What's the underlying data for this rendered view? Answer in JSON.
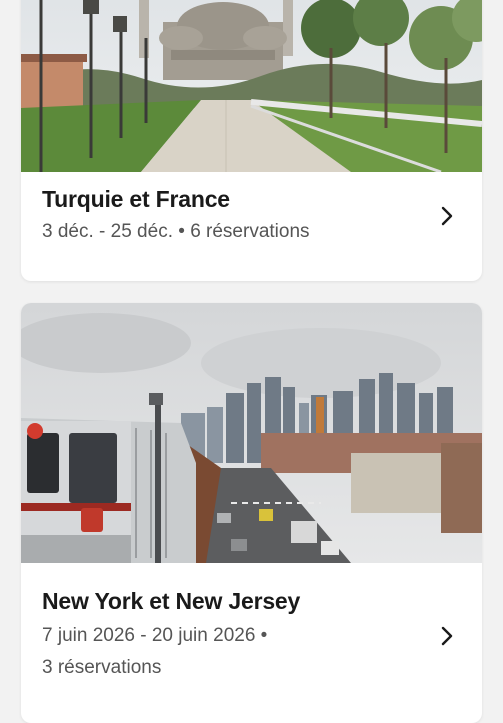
{
  "trips": [
    {
      "title": "Turquie et France",
      "dates": "3 déc. - 25 déc.",
      "reservations": "6 réservations",
      "photo_icon": "istanbul-mosque-photo"
    },
    {
      "title": "New York et New Jersey",
      "dates": "7 juin 2026 - 20 juin 2026",
      "reservations": "3 réservations",
      "photo_icon": "new-york-subway-photo"
    }
  ],
  "separator": "•",
  "chevron_icon": "chevron-right-icon",
  "colors": {
    "background": "#f2f2f2",
    "card": "#ffffff",
    "title": "#1a1a1a",
    "meta": "#555555"
  }
}
